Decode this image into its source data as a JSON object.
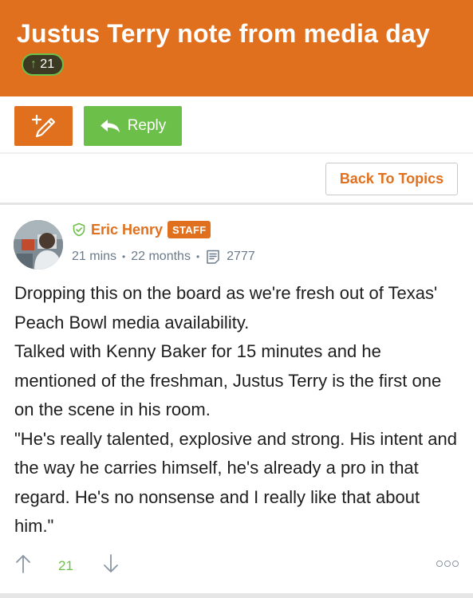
{
  "topic": {
    "title": "Justus Terry note from media day",
    "vote_count": "21"
  },
  "toolbar": {
    "reply_label": "Reply",
    "back_label": "Back To Topics"
  },
  "post": {
    "author": "Eric Henry",
    "badge": "STAFF",
    "time": "21 mins",
    "age": "22 months",
    "views": "2777",
    "body": [
      "Dropping this on the board as we're fresh out of Texas' Peach Bowl media availability.",
      "Talked with Kenny Baker for 15 minutes and he mentioned of the freshman, Justus Terry is the first one on the scene in his room.",
      "\"He's really talented, explosive and strong. His intent and the way he carries himself, he's already a pro in that regard. He's no nonsense and I really like that about him.\""
    ],
    "vote_count": "21"
  },
  "colors": {
    "accent": "#e0701e",
    "reply_green": "#6cc04a",
    "meta_gray": "#6b7b8c"
  },
  "icons": {
    "edit": "pencil-plus-icon",
    "reply": "reply-arrow-icon",
    "verified": "shield-check-icon",
    "views": "document-lines-icon",
    "upvote": "arrow-up-icon",
    "downvote": "arrow-down-icon",
    "more": "more-dots-icon"
  }
}
